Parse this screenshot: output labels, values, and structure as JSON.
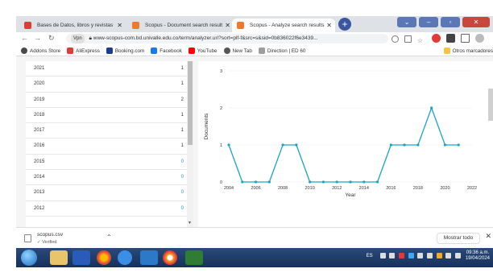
{
  "browser": {
    "tabs": [
      {
        "label": "Bases de Datos, libros y revistas",
        "color": "#e53935"
      },
      {
        "label": "Scopus - Document search result",
        "color": "#f4772e"
      },
      {
        "label": "Scopus - Analyze search results",
        "color": "#f4772e"
      }
    ],
    "new_tab": "+",
    "url_badge": "Vpn",
    "url": "www-scopus-com.bd.univalle.edu.co/term/analyzer.uri?sort=plf-f&src=s&sid=0b836022f6e3439..."
  },
  "bookmarks": {
    "items": [
      {
        "label": "Addons Store",
        "color": "#4a4a4a"
      },
      {
        "label": "AliExpress",
        "color": "#e53935"
      },
      {
        "label": "Booking.com",
        "color": "#1e3c8c"
      },
      {
        "label": "Facebook",
        "color": "#1877f2"
      },
      {
        "label": "YouTube",
        "color": "#ff0000"
      },
      {
        "label": "New Tab",
        "color": "#555555"
      },
      {
        "label": "Direction | ED 60",
        "color": "#9e9e9e"
      }
    ],
    "other": "Otros marcadores"
  },
  "year_list": [
    {
      "year": "2021",
      "count": "1"
    },
    {
      "year": "2020",
      "count": "1"
    },
    {
      "year": "2019",
      "count": "2"
    },
    {
      "year": "2018",
      "count": "1"
    },
    {
      "year": "2017",
      "count": "1"
    },
    {
      "year": "2016",
      "count": "1"
    },
    {
      "year": "2015",
      "count": "0"
    },
    {
      "year": "2014",
      "count": "0"
    },
    {
      "year": "2013",
      "count": "0"
    },
    {
      "year": "2012",
      "count": "0"
    }
  ],
  "chart_data": {
    "type": "line",
    "x": [
      2004,
      2005,
      2006,
      2007,
      2008,
      2009,
      2010,
      2011,
      2012,
      2013,
      2014,
      2015,
      2016,
      2017,
      2018,
      2019,
      2020,
      2021
    ],
    "series": [
      {
        "values": [
          1,
          0,
          0,
          0,
          1,
          1,
          0,
          0,
          0,
          0,
          0,
          0,
          1,
          1,
          1,
          2,
          1,
          1
        ]
      }
    ],
    "xlabel": "Year",
    "ylabel": "Documents",
    "xlim": [
      2004,
      2022
    ],
    "ylim": [
      0,
      3
    ],
    "xticks": [
      "2004",
      "2006",
      "2008",
      "2010",
      "2012",
      "2014",
      "2016",
      "2018",
      "2020",
      "2022"
    ],
    "yticks": [
      "0",
      "1",
      "2",
      "3"
    ],
    "color": "#1aa3c4",
    "grid": true
  },
  "download": {
    "filename": "scopus.csv",
    "status": "Verified",
    "show_all": "Mostrar todo"
  },
  "taskbar": {
    "lang": "ES",
    "time": "09:36 a.m.",
    "date": "19/04/2024"
  }
}
